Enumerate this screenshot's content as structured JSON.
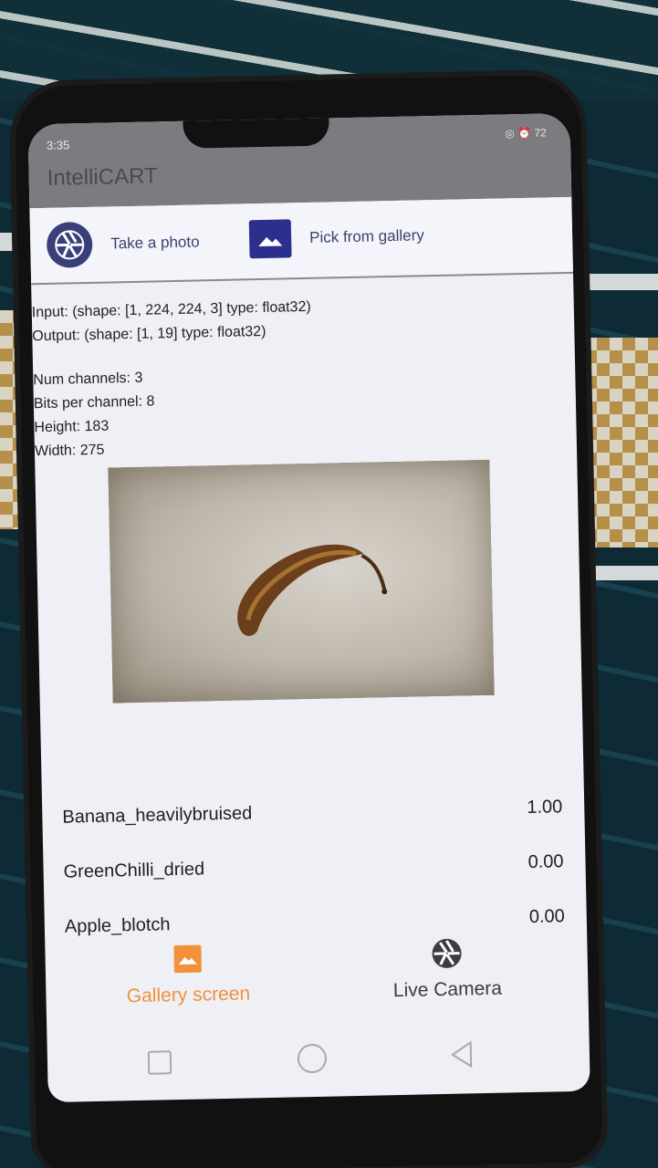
{
  "status_bar": {
    "time": "3:35",
    "indicators": "◎ ⏰ 72"
  },
  "app": {
    "title": "IntelliCART"
  },
  "actions": {
    "take_photo_label": "Take a photo",
    "pick_gallery_label": "Pick from gallery"
  },
  "info": {
    "input": "Input: (shape: [1, 224, 224, 3] type: float32)",
    "output": "Output: (shape: [1, 19] type: float32)",
    "num_channels": "Num channels: 3",
    "bits_per_channel": "Bits per channel: 8",
    "height": "Height: 183",
    "width": "Width: 275"
  },
  "results": [
    {
      "label": "Banana_heavilybruised",
      "score": "1.00"
    },
    {
      "label": "GreenChilli_dried",
      "score": "0.00"
    },
    {
      "label": "Apple_blotch",
      "score": "0.00"
    }
  ],
  "bottom_nav": {
    "gallery_label": "Gallery screen",
    "camera_label": "Live Camera"
  },
  "colors": {
    "accent_active": "#f3903a",
    "icon_indigo": "#2c2f8c",
    "app_bar": "#7c7c80"
  }
}
